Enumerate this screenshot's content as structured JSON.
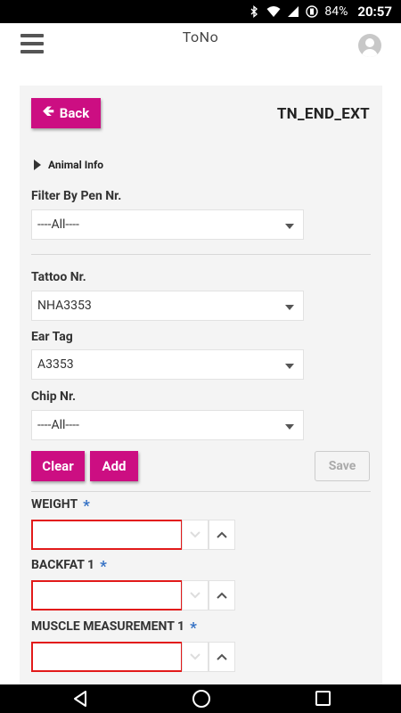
{
  "status_bar": {
    "battery_percent": "84%",
    "time": "20:57",
    "icons": [
      "bluetooth-icon",
      "wifi-icon",
      "no-sim-icon",
      "battery-saver-icon"
    ]
  },
  "app": {
    "title": "ToNo",
    "menu_icon": "hamburger-menu-icon",
    "profile_icon": "user-avatar-icon"
  },
  "form": {
    "back_label": "Back",
    "title": "TN_END_EXT",
    "animal_info_label": "Animal Info",
    "filter_pen": {
      "label": "Filter By Pen Nr.",
      "value": "----All----"
    },
    "tattoo": {
      "label": "Tattoo Nr.",
      "value": "NHA3353"
    },
    "ear_tag": {
      "label": "Ear Tag",
      "value": "A3353"
    },
    "chip": {
      "label": "Chip Nr.",
      "value": "----All----"
    },
    "clear_label": "Clear",
    "add_label": "Add",
    "save_label": "Save",
    "required_marker": "*",
    "measurements": [
      {
        "label": "WEIGHT",
        "value": ""
      },
      {
        "label": "BACKFAT 1",
        "value": ""
      },
      {
        "label": "MUSCLE MEASUREMENT 1",
        "value": ""
      }
    ]
  },
  "colors": {
    "accent": "#cc0e82",
    "error_border": "#e21a1a",
    "required_star": "#3370c4"
  }
}
